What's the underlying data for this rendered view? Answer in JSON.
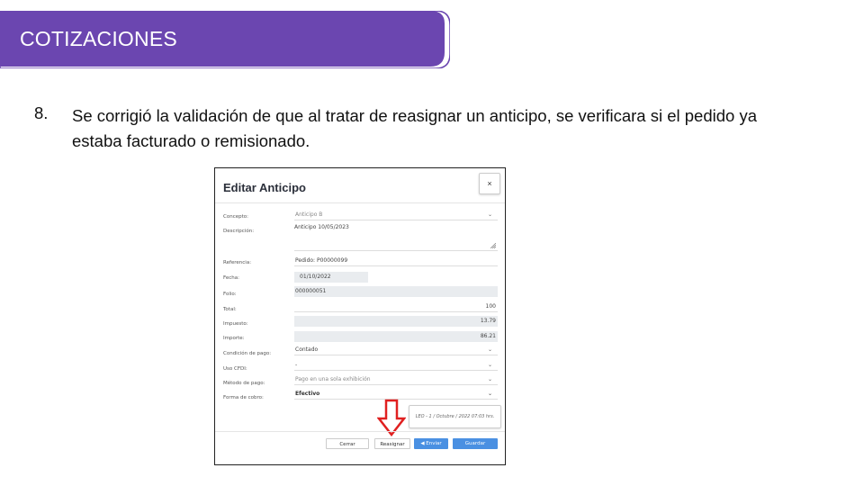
{
  "slide": {
    "title": "COTIZACIONES",
    "item_number": "8.",
    "item_text": "Se corrigió la validación de que al tratar de reasignar un anticipo, se verificara si el pedido ya estaba facturado o remisionado."
  },
  "dialog": {
    "title": "Editar Anticipo",
    "close_label": "×",
    "fields": {
      "concepto": {
        "label": "Concepto:",
        "value": "Anticipo B"
      },
      "descripcion": {
        "label": "Descripción:",
        "value": "Anticipo 10/05/2023"
      },
      "referencia": {
        "label": "Referencia:",
        "value": "Pedido: P00000099"
      },
      "fecha": {
        "label": "Fecha:",
        "value": "01/10/2022"
      },
      "folio": {
        "label": "Folio:",
        "value": "000000051"
      },
      "total": {
        "label": "Total:",
        "value": "100"
      },
      "impuesto": {
        "label": "Impuesto:",
        "value": "13.79"
      },
      "importe": {
        "label": "Importe:",
        "value": "86.21"
      },
      "condicion_pago": {
        "label": "Condición de pago:",
        "value": "Contado"
      },
      "uso_cfdi": {
        "label": "Uso CFDI:",
        "value": "-"
      },
      "metodo_pago": {
        "label": "Método de pago:",
        "value": "Pago en una sola exhibición"
      },
      "forma_cobro": {
        "label": "Forma de cobro:",
        "value": "Efectivo"
      }
    },
    "stamp": "LEO - 1 / Octubre / 2022 07:03 hrs.",
    "buttons": {
      "cerrar": "Cerrar",
      "reasignar": "Reasignar",
      "enviar": "◀ Enviar",
      "guardar": "Guardar"
    }
  },
  "colors": {
    "banner": "#6b46b0",
    "arrow": "#e02020",
    "primary_button": "#4a90e2"
  }
}
